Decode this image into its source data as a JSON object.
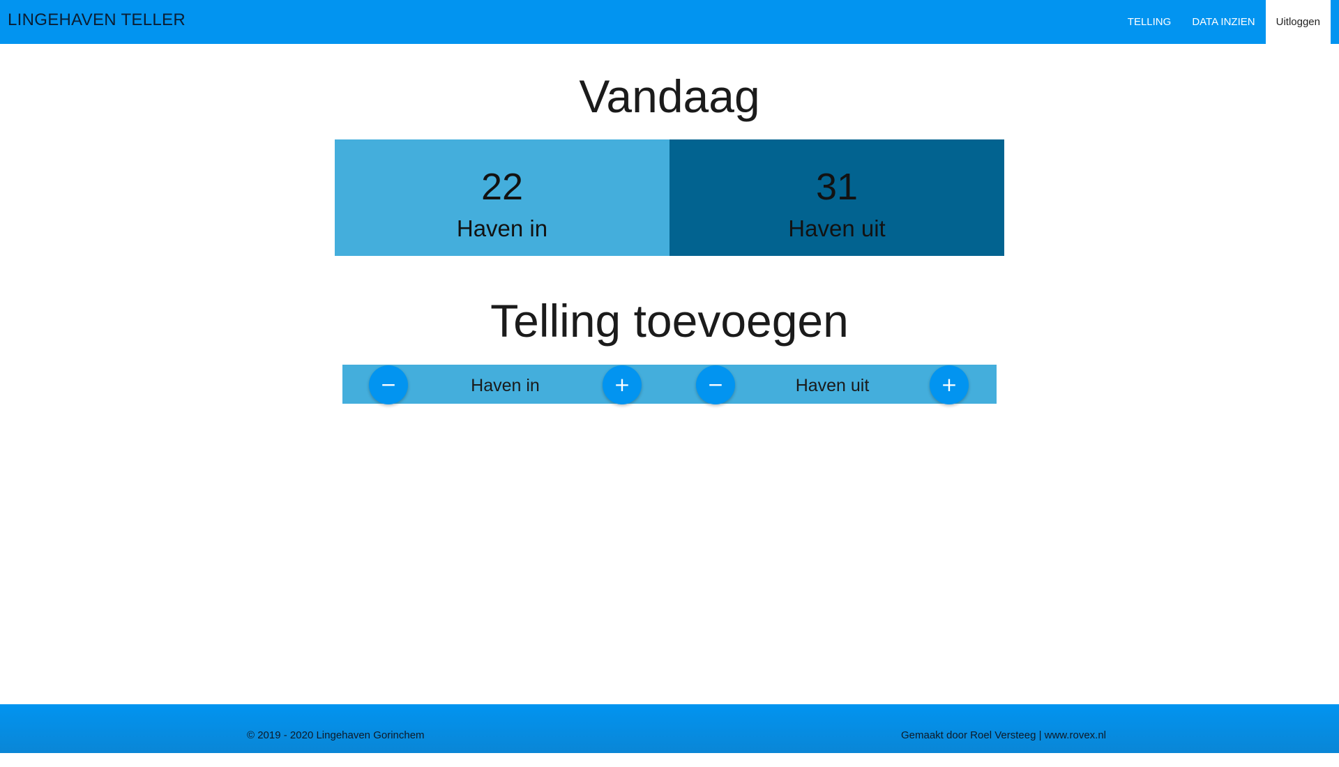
{
  "navbar": {
    "brand": "LINGEHAVEN TELLER",
    "items": [
      {
        "label": "TELLING"
      },
      {
        "label": "DATA INZIEN"
      },
      {
        "label": "Uitloggen"
      }
    ]
  },
  "today": {
    "title": "Vandaag",
    "haven_in": {
      "value": "22",
      "label": "Haven in"
    },
    "haven_uit": {
      "value": "31",
      "label": "Haven uit"
    }
  },
  "add_count": {
    "title": "Telling toevoegen",
    "haven_in": {
      "label": "Haven in",
      "minus": "−",
      "plus": "+"
    },
    "haven_uit": {
      "label": "Haven uit",
      "minus": "−",
      "plus": "+"
    }
  },
  "footer": {
    "left": "© 2019 - 2020 Lingehaven Gorinchem",
    "right": "Gemaakt door Roel Versteeg | www.rovex.nl"
  },
  "colors": {
    "primary": "#0294f0",
    "light_blue": "#44aedc",
    "dark_blue": "#026390"
  }
}
